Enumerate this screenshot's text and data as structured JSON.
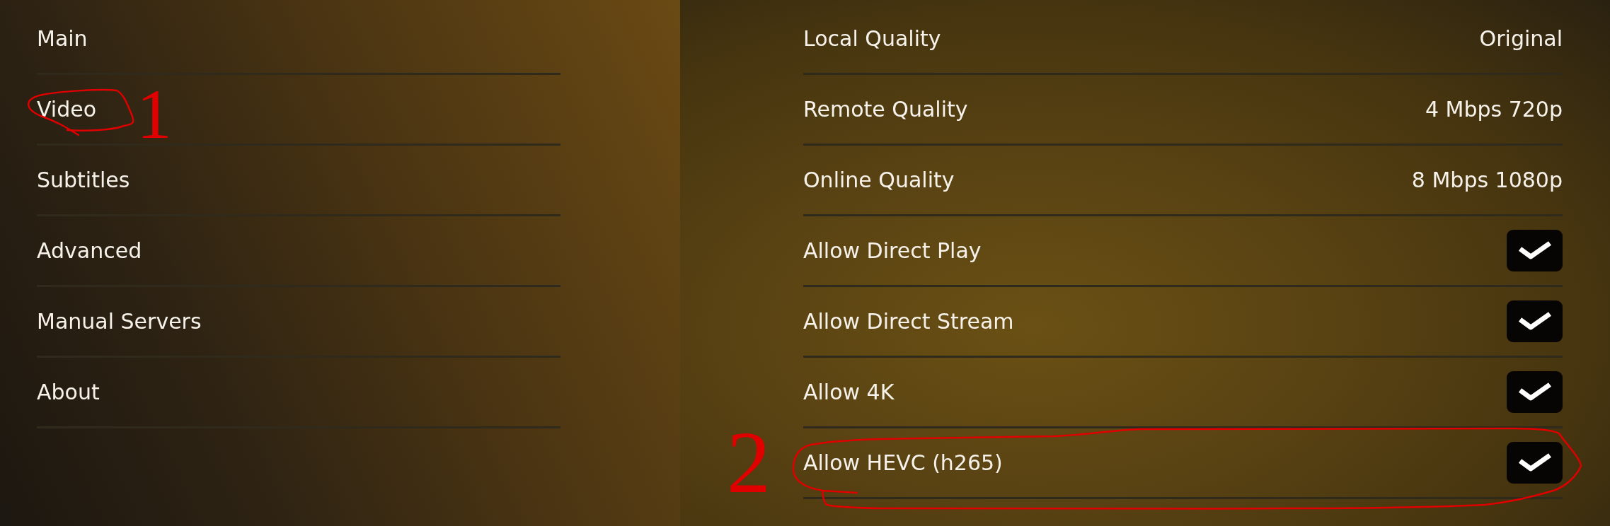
{
  "navigation": {
    "items": [
      {
        "label": "Main"
      },
      {
        "label": "Video",
        "annotation": {
          "label": "1"
        }
      },
      {
        "label": "Subtitles"
      },
      {
        "label": "Advanced"
      },
      {
        "label": "Manual Servers"
      },
      {
        "label": "About"
      }
    ]
  },
  "settings": {
    "items": [
      {
        "kind": "value",
        "label": "Local Quality",
        "value": "Original"
      },
      {
        "kind": "value",
        "label": "Remote Quality",
        "value": "4 Mbps 720p"
      },
      {
        "kind": "value",
        "label": "Online Quality",
        "value": "8 Mbps 1080p"
      },
      {
        "kind": "toggle",
        "label": "Allow Direct Play",
        "checked": true
      },
      {
        "kind": "toggle",
        "label": "Allow Direct Stream",
        "checked": true
      },
      {
        "kind": "toggle",
        "label": "Allow 4K",
        "checked": true
      },
      {
        "kind": "toggle",
        "label": "Allow HEVC (h265)",
        "checked": true,
        "annotation": {
          "label": "2"
        }
      }
    ]
  }
}
